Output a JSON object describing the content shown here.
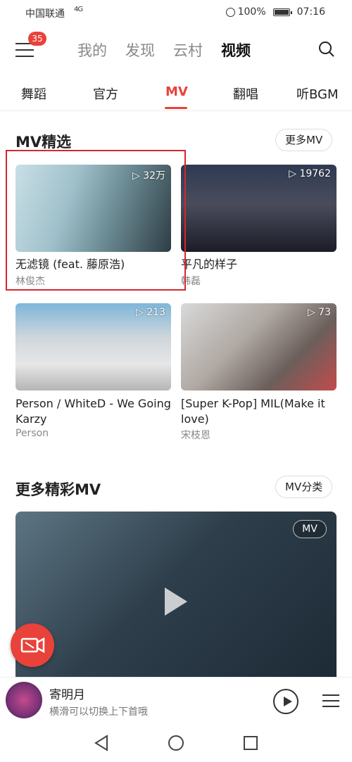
{
  "status_bar": {
    "carrier": "中国联通",
    "signal": "4G",
    "battery": "100%",
    "time": "07:16"
  },
  "top_nav": {
    "badge": "35",
    "tabs": [
      "我的",
      "发现",
      "云村",
      "视频"
    ],
    "active_tab": "视频"
  },
  "sub_tabs": {
    "items": [
      "舞蹈",
      "官方",
      "MV",
      "翻唱",
      "听BGM"
    ],
    "active": "MV"
  },
  "mv_section": {
    "title": "MV精选",
    "more_button": "更多MV",
    "items": [
      {
        "title": "无滤镜 (feat. 藤原浩)",
        "artist": "林俊杰",
        "plays": "32万"
      },
      {
        "title": "平凡的样子",
        "artist": "韩磊",
        "plays": "19762"
      },
      {
        "title": "Person / WhiteD - We Going Karzy",
        "artist": "Person",
        "plays": "213"
      },
      {
        "title": "[Super K-Pop] MIL(Make it love)",
        "artist": "宋枝恩",
        "plays": "73"
      }
    ]
  },
  "more_section": {
    "title": "更多精彩MV",
    "category_button": "MV分类",
    "video_tag": "MV"
  },
  "mini_player": {
    "song": "寄明月",
    "hint": "横滑可以切换上下首哦"
  },
  "colors": {
    "accent": "#e8423a",
    "highlight_box": "#d4272e"
  }
}
